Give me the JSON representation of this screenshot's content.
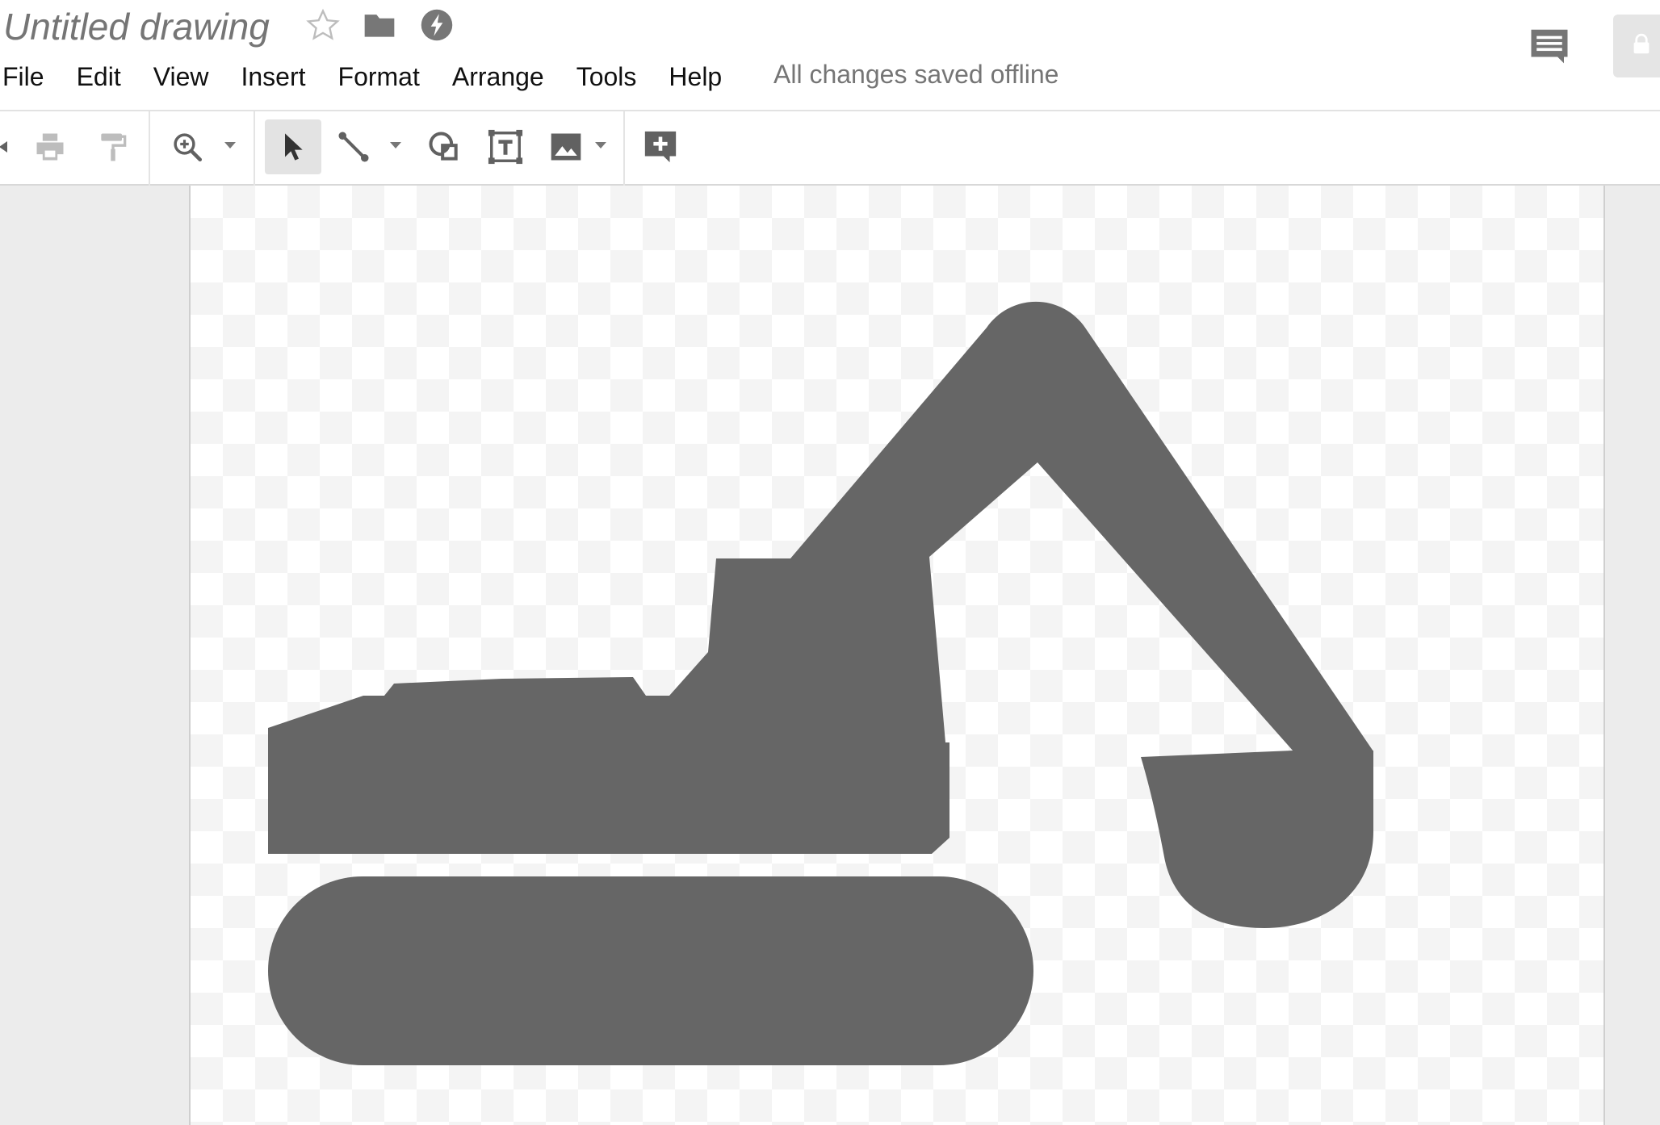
{
  "document": {
    "title": "Untitled drawing",
    "save_status": "All changes saved offline"
  },
  "menu": [
    {
      "label": "File"
    },
    {
      "label": "Edit"
    },
    {
      "label": "View"
    },
    {
      "label": "Insert"
    },
    {
      "label": "Format"
    },
    {
      "label": "Arrange"
    },
    {
      "label": "Tools"
    },
    {
      "label": "Help"
    }
  ],
  "title_icons": [
    "star-icon",
    "folder-icon",
    "offline-bolt-icon"
  ],
  "header_actions": [
    "comments-icon",
    "lock-icon"
  ],
  "toolbar": {
    "buttons": [
      "undo-icon",
      "print-icon",
      "paint-format-icon",
      "zoom-icon",
      "select-cursor-icon",
      "line-icon",
      "shape-icon",
      "text-box-icon",
      "image-icon",
      "comment-add-icon"
    ],
    "active_tool": "select-cursor-icon"
  },
  "canvas": {
    "shape": "excavator",
    "fill_color": "#666666",
    "background": "transparent-checkerboard"
  },
  "colors": {
    "icon_gray": "#616161",
    "disabled_gray": "#bdbdbd",
    "active_tool_bg": "#e3e3e3"
  }
}
